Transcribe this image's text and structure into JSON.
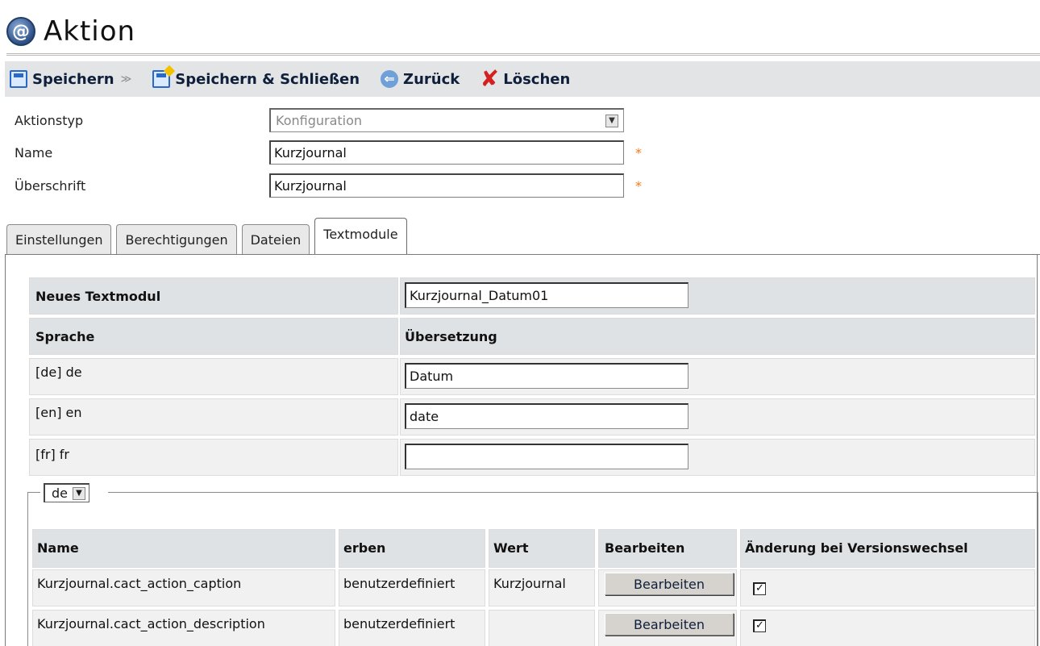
{
  "window": {
    "title": "Aktion",
    "title_icon": "action-logo-icon"
  },
  "toolbar": {
    "save": "Speichern",
    "save_close": "Speichern & Schließen",
    "back": "Zurück",
    "delete": "Löschen"
  },
  "form": {
    "aktionstyp_label": "Aktionstyp",
    "aktionstyp_value": "Konfiguration",
    "name_label": "Name",
    "name_value": "Kurzjournal",
    "ueberschrift_label": "Überschrift",
    "ueberschrift_value": "Kurzjournal",
    "required_mark": "*"
  },
  "tabs": [
    {
      "label": "Einstellungen",
      "active": false
    },
    {
      "label": "Berechtigungen",
      "active": false
    },
    {
      "label": "Dateien",
      "active": false
    },
    {
      "label": "Textmodule",
      "active": true
    }
  ],
  "textmodule": {
    "new_label": "Neues Textmodul",
    "new_value": "Kurzjournal_Datum01",
    "col_language": "Sprache",
    "col_translation": "Übersetzung",
    "rows": [
      {
        "language": "[de]  de",
        "value": "Datum"
      },
      {
        "language": "[en]  en",
        "value": "date"
      },
      {
        "language": "[fr]  fr",
        "value": ""
      }
    ]
  },
  "language_filter": {
    "selected": "de"
  },
  "modules_table": {
    "headers": [
      "Name",
      "erben",
      "Wert",
      "Bearbeiten",
      "Änderung bei Versionswechsel"
    ],
    "rows": [
      {
        "name": "Kurzjournal.cact_action_caption",
        "erben": "benutzerdefiniert",
        "wert": "Kurzjournal",
        "button": "Bearbeiten",
        "checked": "☑"
      },
      {
        "name": "Kurzjournal.cact_action_description",
        "erben": "benutzerdefiniert",
        "wert": "",
        "button": "Bearbeiten",
        "checked": "☑"
      }
    ]
  }
}
